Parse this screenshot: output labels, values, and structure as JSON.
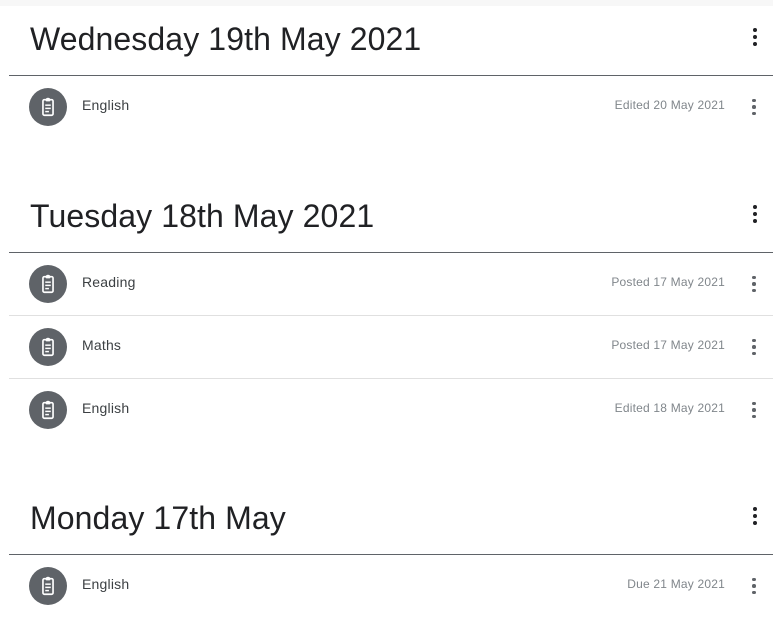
{
  "icons": {
    "assignment": "clipboard-icon",
    "more": "more-vert-icon"
  },
  "colors": {
    "icon_circle": "#5f6368",
    "divider": "#5f6368",
    "row_divider": "#e0e0e0",
    "meta_text": "#80868b"
  },
  "topics": [
    {
      "title": "Wednesday 19th May 2021",
      "items": [
        {
          "title": "English",
          "meta": "Edited 20 May 2021"
        }
      ]
    },
    {
      "title": "Tuesday 18th May 2021",
      "items": [
        {
          "title": "Reading",
          "meta": "Posted 17 May 2021"
        },
        {
          "title": "Maths",
          "meta": "Posted 17 May 2021"
        },
        {
          "title": "English",
          "meta": "Edited 18 May 2021"
        }
      ]
    },
    {
      "title": "Monday 17th May",
      "items": [
        {
          "title": "English",
          "meta": "Due 21 May 2021"
        }
      ]
    }
  ]
}
